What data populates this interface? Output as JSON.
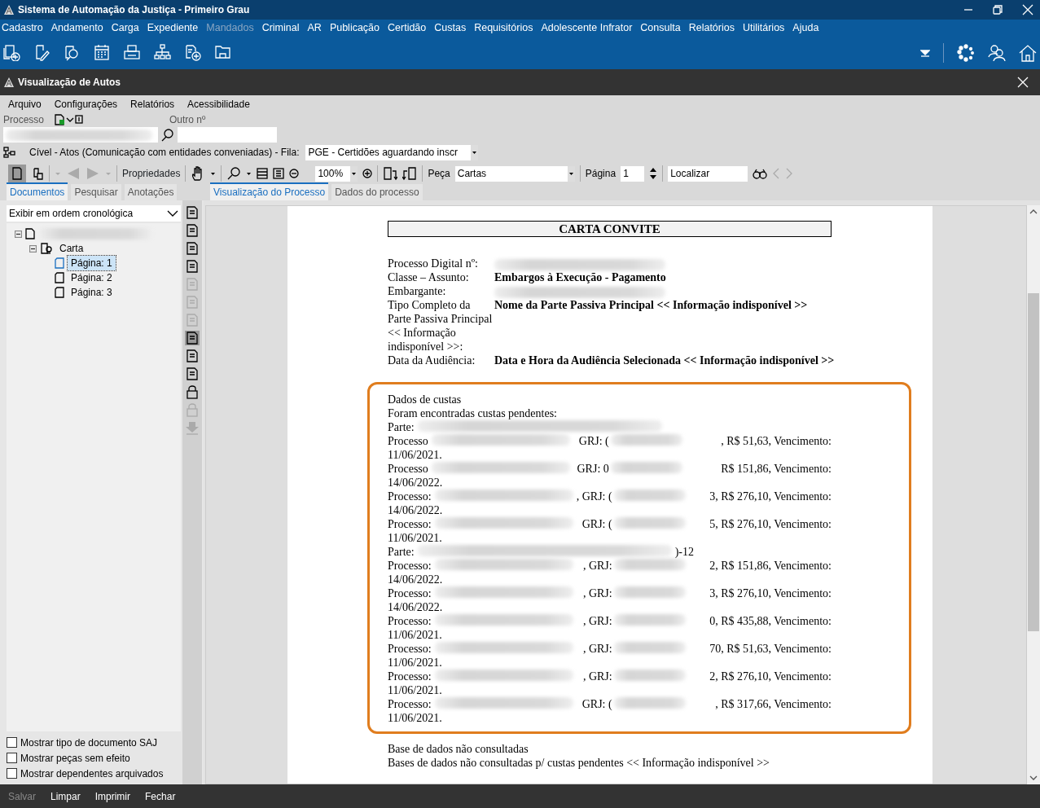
{
  "window": {
    "title": "Sistema de Automação da Justiça - Primeiro Grau"
  },
  "main_menu": [
    {
      "label": "Cadastro",
      "disabled": false
    },
    {
      "label": "Andamento",
      "disabled": false
    },
    {
      "label": "Carga",
      "disabled": false
    },
    {
      "label": "Expediente",
      "disabled": false
    },
    {
      "label": "Mandados",
      "disabled": true
    },
    {
      "label": "Criminal",
      "disabled": false
    },
    {
      "label": "AR",
      "disabled": false
    },
    {
      "label": "Publicação",
      "disabled": false
    },
    {
      "label": "Certidão",
      "disabled": false
    },
    {
      "label": "Custas",
      "disabled": false
    },
    {
      "label": "Requisitórios",
      "disabled": false
    },
    {
      "label": "Adolescente Infrator",
      "disabled": false
    },
    {
      "label": "Consulta",
      "disabled": false
    },
    {
      "label": "Relatórios",
      "disabled": false
    },
    {
      "label": "Utilitários",
      "disabled": false
    },
    {
      "label": "Ajuda",
      "disabled": false
    }
  ],
  "child_window": {
    "title": "Visualização de Autos"
  },
  "window_menu": [
    "Arquivo",
    "Configurações",
    "Relatórios",
    "Acessibilidade"
  ],
  "search": {
    "process_label": "Processo",
    "other_label": "Outro nº"
  },
  "queue": {
    "text": "Cível - Atos (Comunicação com entidades conveniadas) - Fila:",
    "value": "PGE - Certidões aguardando inscr"
  },
  "viewer_toolbar": {
    "properties": "Propriedades",
    "zoom": "100%",
    "piece_label": "Peça",
    "piece_value": "Cartas",
    "page_label": "Página",
    "page_value": "1",
    "find_value": "Localizar"
  },
  "left_tabs": [
    {
      "label": "Documentos",
      "selected": true
    },
    {
      "label": "Pesquisar",
      "selected": false
    },
    {
      "label": "Anotações",
      "selected": false
    }
  ],
  "view_tabs": [
    {
      "label": "Visualização do Processo",
      "selected": true
    },
    {
      "label": "Dados do processo",
      "selected": false
    }
  ],
  "document_order": "Exibir em ordem cronológica",
  "tree": [
    {
      "redacted": true,
      "expanded": true,
      "children": [
        {
          "label": "Carta",
          "expanded": true,
          "children": [
            {
              "label": "Página: 1",
              "selected": true
            },
            {
              "label": "Página: 2",
              "selected": false
            },
            {
              "label": "Página: 3",
              "selected": false
            }
          ]
        }
      ]
    }
  ],
  "options": [
    {
      "label": "Mostrar tipo de documento SAJ",
      "checked": false
    },
    {
      "label": "Mostrar peças sem efeito",
      "checked": false
    },
    {
      "label": "Mostrar dependentes arquivados",
      "checked": false
    }
  ],
  "document": {
    "title": "CARTA CONVITE",
    "fields": [
      {
        "label": "Processo Digital nº:",
        "redacted": true
      },
      {
        "label": "Classe – Assunto:",
        "value": "Embargos à Execução - Pagamento"
      },
      {
        "label": "Embargante:",
        "redacted": true
      },
      {
        "label": "Tipo Completo da Parte Passiva Principal << Informação indisponível >>:",
        "value": "Nome da Parte Passiva Principal << Informação indisponível >>"
      },
      {
        "label": "Data da Audiência:",
        "value": "Data e Hora da Audiência Selecionada << Informação indisponível >>"
      }
    ],
    "costs": {
      "intro": [
        "Dados de custas",
        "Foram encontradas custas pendentes:"
      ],
      "lines": [
        {
          "kind": "party",
          "label": "Parte:"
        },
        {
          "kind": "process",
          "label": "Processo",
          "grj": "GRJ: (",
          "tail": ", R$ 51,63, Vencimento:",
          "date": "11/06/2021."
        },
        {
          "kind": "process",
          "label": "Processo",
          "grj": "GRJ: 0",
          "tail": "R$ 151,86, Vencimento:",
          "date": "14/06/2022."
        },
        {
          "kind": "process",
          "label": "Processo:",
          "grj": ", GRJ: (",
          "tail": "3, R$ 276,10, Vencimento:",
          "date": "14/06/2022."
        },
        {
          "kind": "process",
          "label": "Processo:",
          "grj": "GRJ: (",
          "tail": "5, R$ 276,10, Vencimento:",
          "date": "11/06/2021."
        },
        {
          "kind": "party",
          "label": "Parte:",
          "tail": ")-12"
        },
        {
          "kind": "process",
          "label": "Processo:",
          "grj": ", GRJ:",
          "tail": "2, R$ 151,86, Vencimento:",
          "date": "14/06/2022."
        },
        {
          "kind": "process",
          "label": "Processo:",
          "grj": ", GRJ:",
          "tail": "3, R$ 276,10, Vencimento:",
          "date": "14/06/2022."
        },
        {
          "kind": "process",
          "label": "Processo:",
          "grj": ", GRJ:",
          "tail": "0, R$ 435,88, Vencimento:",
          "date": "11/06/2021."
        },
        {
          "kind": "process",
          "label": "Processo:",
          "grj": ", GRJ:",
          "tail": "70, R$ 51,63, Vencimento:",
          "date": "11/06/2021."
        },
        {
          "kind": "process",
          "label": "Processo:",
          "grj": ", GRJ:",
          "tail": "2, R$ 276,10, Vencimento:",
          "date": "11/06/2021."
        },
        {
          "kind": "process",
          "label": "Processo:",
          "grj": "GRJ: (",
          "tail": ", R$ 317,66, Vencimento:",
          "date": "11/06/2021."
        }
      ]
    },
    "footer": [
      "Base de dados não consultadas",
      "Bases de dados não consultadas p/ custas pendentes << Informação indisponível >>"
    ]
  },
  "bottom_buttons": [
    {
      "label": "Salvar",
      "disabled": true
    },
    {
      "label": "Limpar",
      "disabled": false
    },
    {
      "label": "Imprimir",
      "disabled": false
    },
    {
      "label": "Fechar",
      "disabled": false
    }
  ]
}
